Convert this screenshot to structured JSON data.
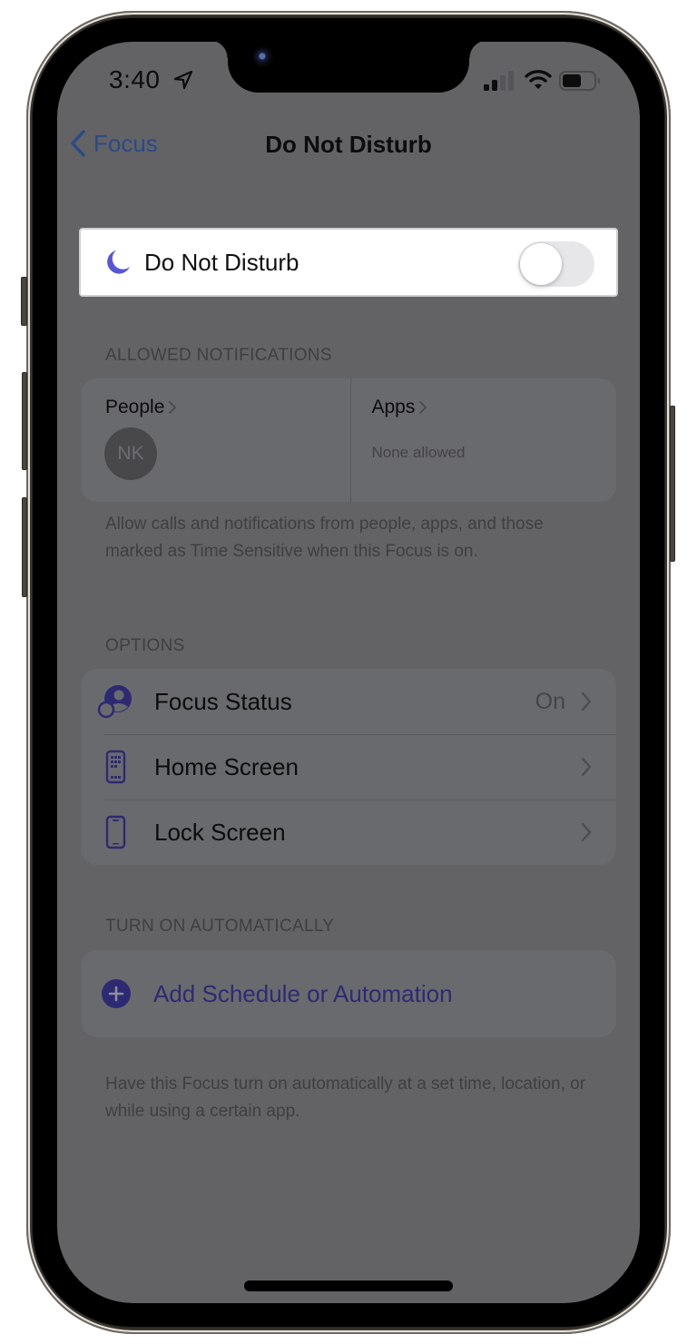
{
  "status_bar": {
    "time": "3:40",
    "location_icon": "location-arrow-icon",
    "signal_icon": "cellular-signal-icon",
    "wifi_icon": "wifi-icon",
    "battery_icon": "battery-icon"
  },
  "nav": {
    "back_label": "Focus",
    "title": "Do Not Disturb"
  },
  "focus_toggle": {
    "icon": "moon-icon",
    "label": "Do Not Disturb",
    "enabled": false
  },
  "allowed_notifications": {
    "header": "ALLOWED NOTIFICATIONS",
    "people": {
      "label": "People",
      "avatars": [
        {
          "initials": "NK"
        }
      ]
    },
    "apps": {
      "label": "Apps",
      "value": "None allowed"
    },
    "footer": "Allow calls and notifications from people, apps, and those marked as Time Sensitive when this Focus is on."
  },
  "options": {
    "header": "OPTIONS",
    "items": [
      {
        "icon": "focus-status-icon",
        "label": "Focus Status",
        "value": "On"
      },
      {
        "icon": "home-screen-icon",
        "label": "Home Screen",
        "value": ""
      },
      {
        "icon": "lock-screen-icon",
        "label": "Lock Screen",
        "value": ""
      }
    ]
  },
  "automation": {
    "header": "TURN ON AUTOMATICALLY",
    "add_label": "Add Schedule or Automation",
    "footer": "Have this Focus turn on automatically at a set time, location, or while using a certain app."
  },
  "colors": {
    "accent": "#5856D6",
    "link_blue": "#2C4A86",
    "dim_background": "#636366"
  }
}
